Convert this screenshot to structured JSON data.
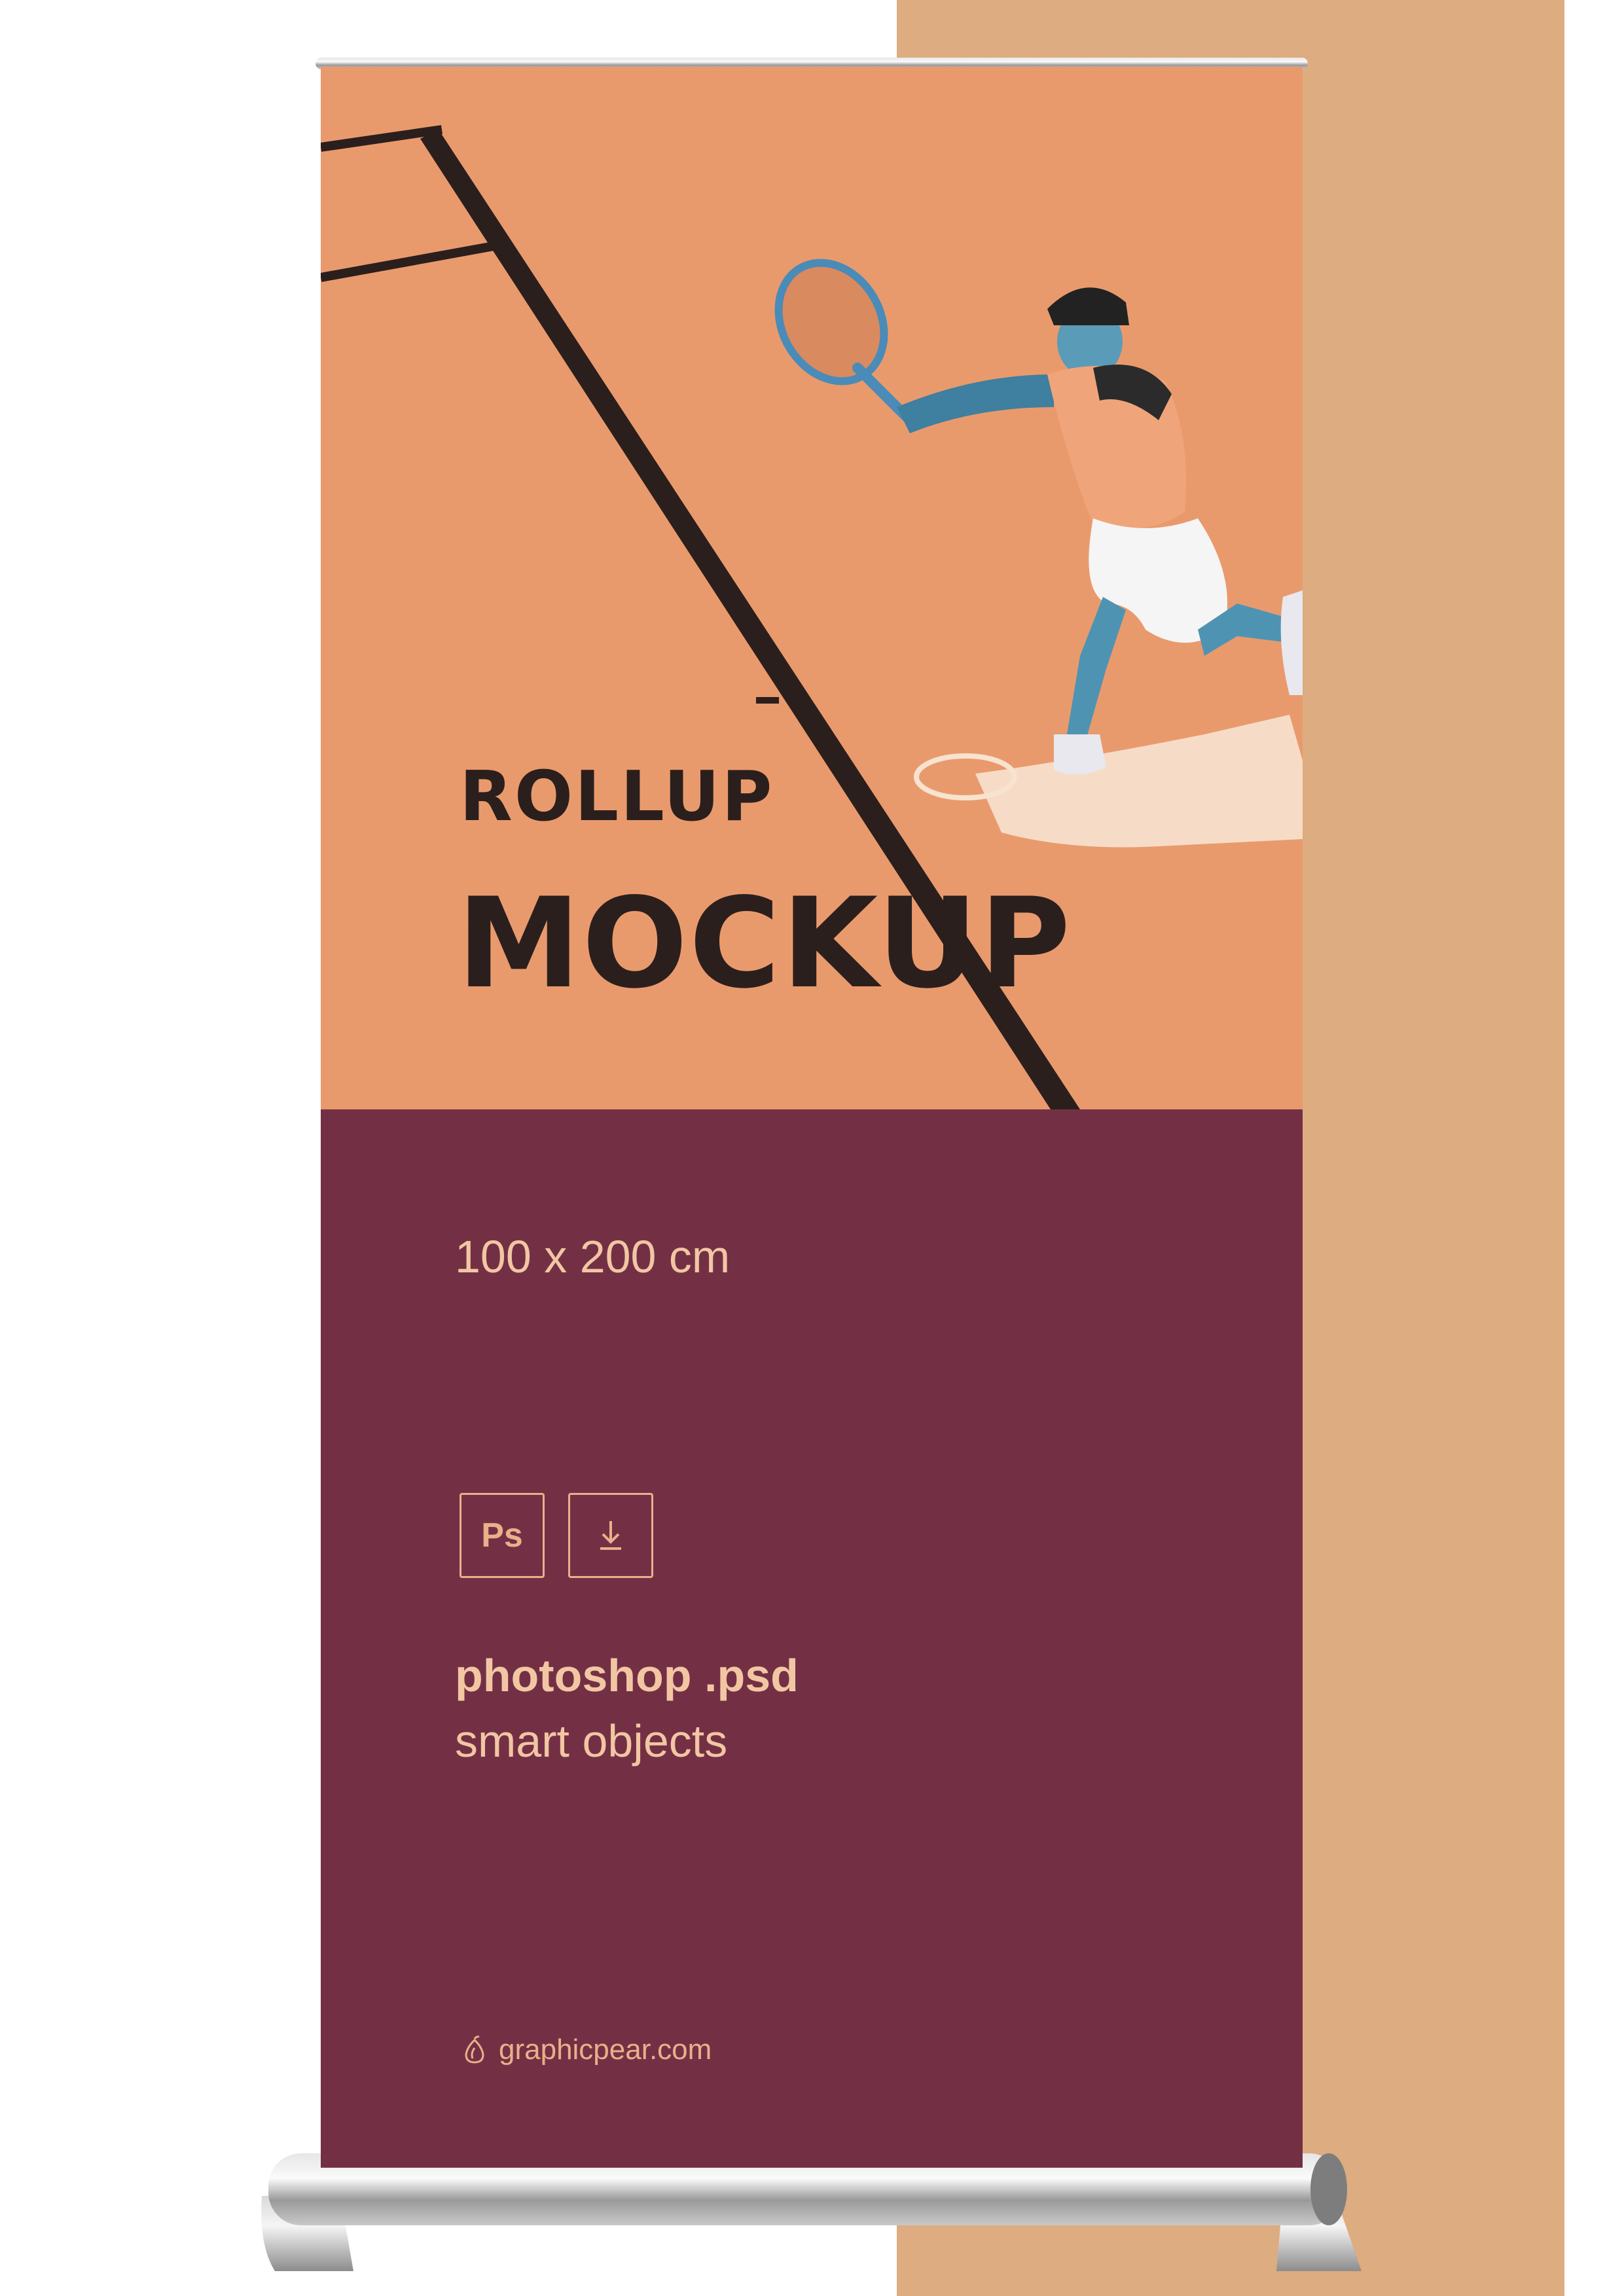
{
  "banner": {
    "headline_line1": "ROLLUP",
    "headline_line2": "MOCKUP",
    "size": "100 x 200 cm",
    "format_line1": "photoshop .psd",
    "format_line2": "smart objects",
    "brand": "graphicpear.com",
    "icons": [
      "photoshop-icon",
      "download-icon",
      "pear-icon"
    ],
    "ps_icon_label": "Ps"
  },
  "colors": {
    "background_panel": "#ddac80",
    "banner_top": "#e99a6d",
    "banner_bottom": "#733045",
    "headline_text": "#2b1f1d",
    "light_text": "#f2c6a3"
  }
}
